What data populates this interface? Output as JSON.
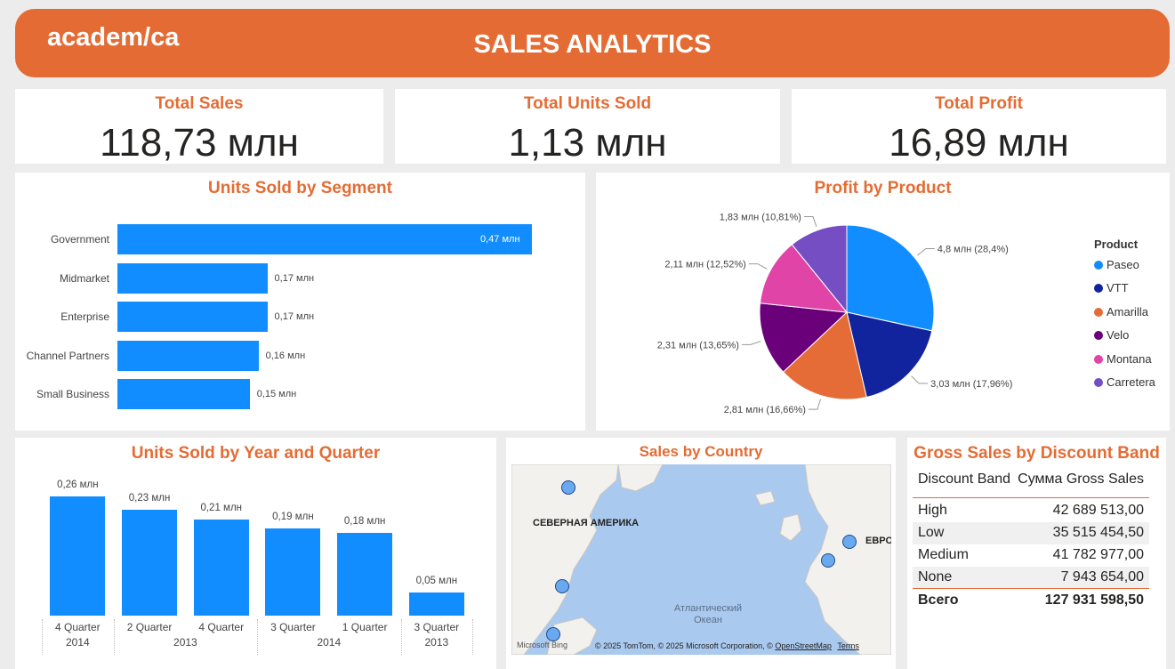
{
  "header": {
    "logo": "academ/ca",
    "title": "SALES ANALYTICS"
  },
  "kpis": [
    {
      "title": "Total Sales",
      "value": "118,73 млн"
    },
    {
      "title": "Total Units Sold",
      "value": "1,13 млн"
    },
    {
      "title": "Total Profit",
      "value": "16,89 млн"
    }
  ],
  "segment_chart": {
    "title": "Units Sold by Segment",
    "chart_data": {
      "type": "bar",
      "orientation": "horizontal",
      "categories": [
        "Government",
        "Midmarket",
        "Enterprise",
        "Channel Partners",
        "Small Business"
      ],
      "values": [
        0.47,
        0.17,
        0.17,
        0.16,
        0.15
      ],
      "labels": [
        "0,47 млн",
        "0,17 млн",
        "0,17 млн",
        "0,16 млн",
        "0,15 млн"
      ],
      "color": "#118dff"
    }
  },
  "product_chart": {
    "title": "Profit by Product",
    "legend_title": "Product",
    "chart_data": {
      "type": "pie",
      "categories": [
        "Paseo",
        "VTT",
        "Amarilla",
        "Velo",
        "Montana",
        "Carretera"
      ],
      "values": [
        4.8,
        3.03,
        2.81,
        2.31,
        2.11,
        1.83
      ],
      "labels": [
        "4,8 млн (28,4%)",
        "3,03 млн (17,96%)",
        "2,81 млн (16,66%)",
        "2,31 млн (13,65%)",
        "2,11 млн (12,52%)",
        "1,83 млн (10,81%)"
      ],
      "colors": [
        "#118dff",
        "#12239e",
        "#e66c37",
        "#6b007b",
        "#e044a7",
        "#744ec2"
      ],
      "legend": "right"
    }
  },
  "quarter_chart": {
    "title": "Units Sold by Year and Quarter",
    "chart_data": {
      "type": "bar",
      "categories": [
        "4 Quarter",
        "2 Quarter",
        "4 Quarter",
        "3 Quarter",
        "1 Quarter",
        "3 Quarter"
      ],
      "years": [
        "2014",
        "2013",
        "2014",
        "2013"
      ],
      "values": [
        0.26,
        0.23,
        0.21,
        0.19,
        0.18,
        0.05
      ],
      "labels": [
        "0,26 млн",
        "0,23 млн",
        "0,21 млн",
        "0,19 млн",
        "0,18 млн",
        "0,05 млн"
      ],
      "color": "#118dff"
    }
  },
  "map_card": {
    "title": "Sales by Country",
    "labels": {
      "north_america": "СЕВЕРНАЯ АМЕРИКА",
      "europe": "ЕВРО",
      "ocean": "Атлантический Океан"
    },
    "credits": {
      "bing": "Microsoft Bing",
      "copyright": "© 2025 TomTom, © 2025 Microsoft Corporation, ©",
      "osm": "OpenStreetMap",
      "terms": "Terms"
    }
  },
  "discount_table": {
    "title": "Gross Sales by Discount Band",
    "headers": [
      "Discount Band",
      "Сумма Gross Sales"
    ],
    "rows": [
      {
        "band": "High",
        "value": "42 689 513,00"
      },
      {
        "band": "Low",
        "value": "35 515 454,50"
      },
      {
        "band": "Medium",
        "value": "41 782 977,00"
      },
      {
        "band": "None",
        "value": "7 943 654,00"
      }
    ],
    "total": {
      "label": "Всего",
      "value": "127 931 598,50"
    }
  }
}
